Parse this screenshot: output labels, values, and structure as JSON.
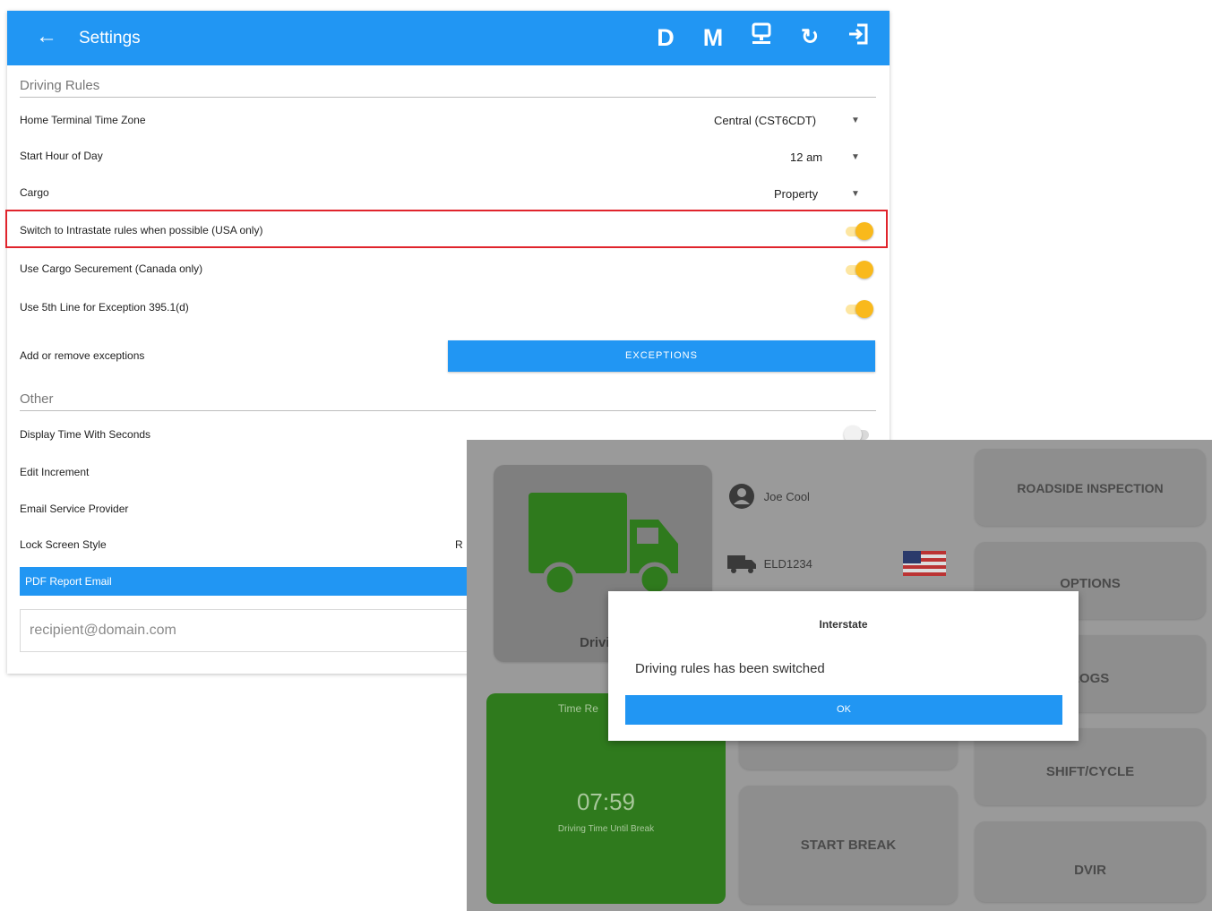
{
  "settings": {
    "title": "Settings",
    "toolbar": {
      "d": "D",
      "m": "M"
    },
    "driving_rules": {
      "section": "Driving Rules",
      "time_zone_label": "Home Terminal Time Zone",
      "time_zone_value": "Central (CST6CDT)",
      "start_hour_label": "Start Hour of Day",
      "start_hour_value": "12 am",
      "cargo_label": "Cargo",
      "cargo_value": "Property",
      "intrastate_label": "Switch to Intrastate rules when possible (USA only)",
      "intrastate_on": true,
      "cargo_secure_label": "Use Cargo Securement (Canada only)",
      "cargo_secure_on": true,
      "line5_label": "Use 5th Line for Exception 395.1(d)",
      "line5_on": true,
      "exceptions_label": "Add or remove exceptions",
      "exceptions_button": "EXCEPTIONS"
    },
    "other": {
      "section": "Other",
      "display_seconds_label": "Display Time With Seconds",
      "display_seconds_on": false,
      "edit_increment_label": "Edit Increment",
      "email_provider_label": "Email Service Provider",
      "lock_screen_label": "Lock Screen Style",
      "lock_screen_value_partial": "R",
      "pdf_report_label": "PDF Report Email",
      "email_placeholder": "recipient@domain.com"
    }
  },
  "dashboard": {
    "driver_name": "Joe Cool",
    "vehicle_id": "ELD1234",
    "status_label": "Driving",
    "clock_label": "Time Re",
    "clock_value": "07:59",
    "clock_caption": "Driving Time Until Break",
    "buttons": {
      "roadside": "ROADSIDE INSPECTION",
      "options": "OPTIONS",
      "logs": "LOGS",
      "shift": "SHIFT/CYCLE",
      "start_break": "START BREAK",
      "dvir": "DVIR"
    },
    "dialog": {
      "title": "Interstate",
      "message": "Driving rules has been switched",
      "ok": "OK"
    },
    "colors": {
      "accent": "#2196f3",
      "toggle_on": "#f9b91c",
      "clock_green": "#2f7a1d",
      "highlight": "#e0242c"
    }
  }
}
